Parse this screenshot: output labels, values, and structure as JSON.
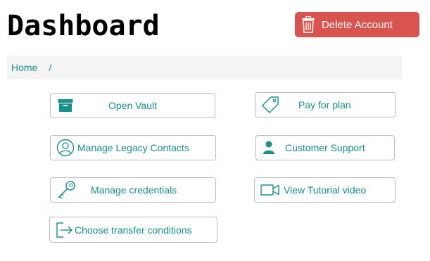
{
  "header": {
    "title": "Dashboard",
    "delete_label": "Delete Account"
  },
  "breadcrumb": {
    "home": "Home",
    "separator": "/"
  },
  "tiles": {
    "open_vault": {
      "label": "Open Vault",
      "icon": "archive-box-icon"
    },
    "pay_for_plan": {
      "label": "Pay for plan",
      "icon": "price-tag-icon"
    },
    "legacy_contacts": {
      "label": "Manage Legacy Contacts",
      "icon": "user-circle-icon"
    },
    "customer_support": {
      "label": "Customer Support",
      "icon": "person-icon"
    },
    "credentials": {
      "label": "Manage credentials",
      "icon": "key-icon"
    },
    "tutorial": {
      "label": "View Tutorial video",
      "icon": "video-camera-icon"
    },
    "transfer": {
      "label": "Choose transfer conditions",
      "icon": "sign-out-icon"
    }
  },
  "colors": {
    "accent": "#17918b",
    "danger": "#d9534f",
    "breadcrumb_bg": "#f4f4f4",
    "tile_border": "#bdbdbd"
  }
}
